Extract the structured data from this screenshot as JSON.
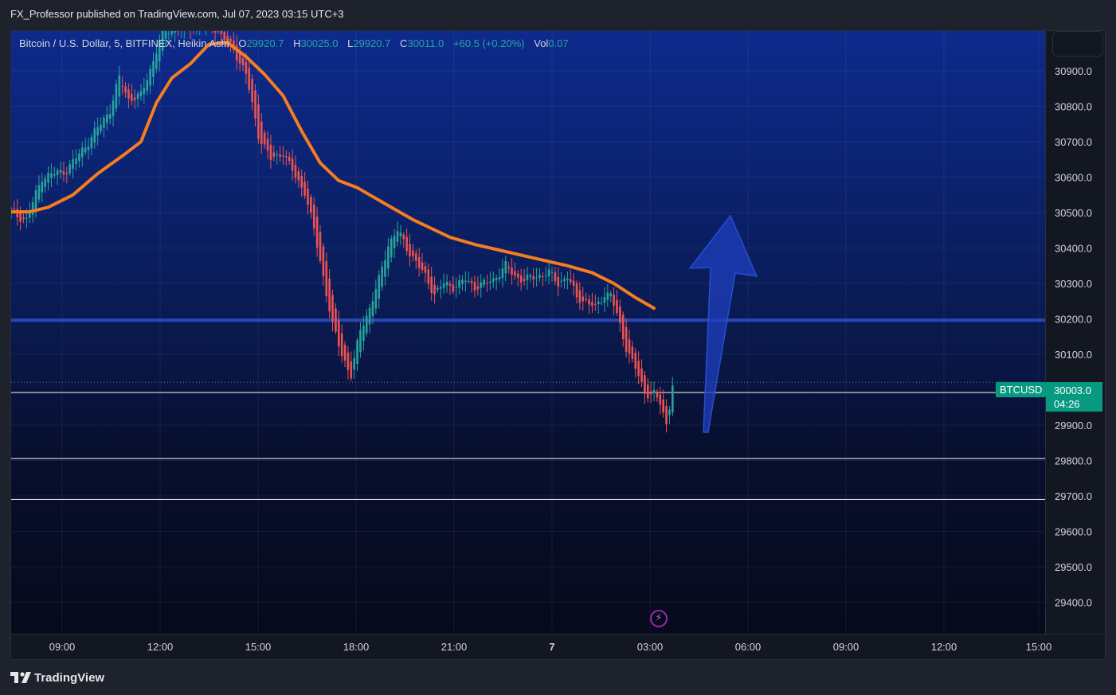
{
  "header": {
    "published": "FX_Professor published on TradingView.com, Jul 07, 2023 03:15 UTC+3"
  },
  "legend": {
    "symbol": "Bitcoin / U.S. Dollar, 5, BITFINEX, Heikin Ashi",
    "o_label": "O",
    "o_value": "29920.7",
    "h_label": "H",
    "h_value": "30025.0",
    "l_label": "L",
    "l_value": "29920.7",
    "c_label": "C",
    "c_value": "30011.0",
    "change": "+60.5 (+0.20%)",
    "vol_label": "Vol",
    "vol_value": "0.07"
  },
  "badges": {
    "symbol": "BTCUSD",
    "last_price": "30003.0",
    "countdown": "04:26"
  },
  "footer": {
    "brand": "TradingView"
  },
  "colors": {
    "up": "#26a69a",
    "down": "#ef5350",
    "ma": "#f57c1f",
    "level_blue": "#2a4cc0",
    "arrow": "#1f3fbf",
    "badge": "#089981"
  },
  "chart_data": {
    "type": "candlestick",
    "symbol": "BTCUSD",
    "y_ticks": [
      30900,
      30800,
      30700,
      30600,
      30500,
      30400,
      30300,
      30200,
      30100,
      29900,
      29800,
      29700,
      29600,
      29500,
      29400
    ],
    "x_ticks": [
      "09:00",
      "12:00",
      "15:00",
      "18:00",
      "21:00",
      "7",
      "03:00",
      "06:00",
      "09:00",
      "12:00",
      "15:00"
    ],
    "ylim": [
      29330,
      31030
    ],
    "horizontal_levels": [
      {
        "price": 30196,
        "style": "blue-thick"
      },
      {
        "price": 29992,
        "style": "white"
      },
      {
        "price": 29806,
        "style": "white"
      },
      {
        "price": 29690,
        "style": "white"
      }
    ],
    "last_price": 30003.0,
    "close_path": [
      [
        0,
        30505
      ],
      [
        2,
        30490
      ],
      [
        5,
        30480
      ],
      [
        10,
        30600
      ],
      [
        18,
        30620
      ],
      [
        25,
        30700
      ],
      [
        32,
        30790
      ],
      [
        35,
        30880
      ],
      [
        38,
        30820
      ],
      [
        42,
        30830
      ],
      [
        46,
        30930
      ],
      [
        49,
        31010
      ],
      [
        60,
        31030
      ],
      [
        65,
        31030
      ],
      [
        72,
        30960
      ],
      [
        76,
        30890
      ],
      [
        80,
        30720
      ],
      [
        84,
        30650
      ],
      [
        88,
        30670
      ],
      [
        92,
        30600
      ],
      [
        95,
        30560
      ],
      [
        98,
        30450
      ],
      [
        101,
        30320
      ],
      [
        104,
        30180
      ],
      [
        107,
        30100
      ],
      [
        110,
        30040
      ],
      [
        113,
        30170
      ],
      [
        116,
        30230
      ],
      [
        119,
        30310
      ],
      [
        122,
        30410
      ],
      [
        125,
        30450
      ],
      [
        128,
        30400
      ],
      [
        131,
        30360
      ],
      [
        134,
        30320
      ],
      [
        137,
        30270
      ],
      [
        140,
        30300
      ],
      [
        143,
        30290
      ],
      [
        147,
        30310
      ],
      [
        150,
        30290
      ],
      [
        153,
        30300
      ],
      [
        156,
        30310
      ],
      [
        160,
        30350
      ],
      [
        163,
        30320
      ],
      [
        166,
        30310
      ],
      [
        170,
        30320
      ],
      [
        174,
        30330
      ],
      [
        177,
        30300
      ],
      [
        180,
        30320
      ],
      [
        183,
        30260
      ],
      [
        186,
        30250
      ],
      [
        189,
        30230
      ],
      [
        192,
        30270
      ],
      [
        194,
        30270
      ],
      [
        196,
        30210
      ],
      [
        199,
        30120
      ],
      [
        202,
        30060
      ],
      [
        205,
        29990
      ],
      [
        208,
        29990
      ],
      [
        210,
        29960
      ],
      [
        212,
        29900
      ],
      [
        214,
        30011
      ]
    ],
    "moving_average": [
      [
        0,
        30502
      ],
      [
        6,
        30502
      ],
      [
        12,
        30515
      ],
      [
        20,
        30550
      ],
      [
        28,
        30610
      ],
      [
        36,
        30660
      ],
      [
        42,
        30700
      ],
      [
        47,
        30810
      ],
      [
        52,
        30880
      ],
      [
        58,
        30920
      ],
      [
        64,
        30975
      ],
      [
        70,
        30980
      ],
      [
        76,
        30940
      ],
      [
        82,
        30890
      ],
      [
        88,
        30830
      ],
      [
        94,
        30730
      ],
      [
        100,
        30640
      ],
      [
        106,
        30590
      ],
      [
        112,
        30570
      ],
      [
        118,
        30540
      ],
      [
        124,
        30510
      ],
      [
        130,
        30480
      ],
      [
        136,
        30455
      ],
      [
        142,
        30430
      ],
      [
        150,
        30410
      ],
      [
        160,
        30390
      ],
      [
        170,
        30370
      ],
      [
        180,
        30350
      ],
      [
        188,
        30330
      ],
      [
        195,
        30300
      ],
      [
        202,
        30260
      ],
      [
        208,
        30230
      ]
    ],
    "annotations": [
      {
        "type": "arrow",
        "direction": "up"
      }
    ]
  }
}
